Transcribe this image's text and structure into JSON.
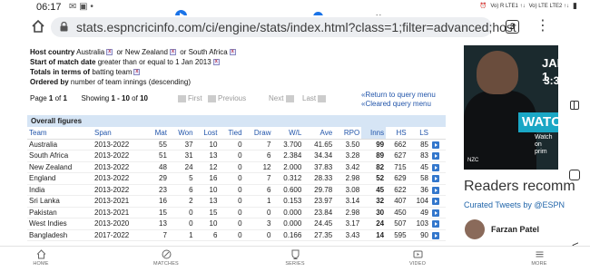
{
  "status": {
    "time": "06:17",
    "network_left": "Vo) R LTE1 ↑↓",
    "network_right": "Vo) LTE LTE2 ↑↓"
  },
  "browser": {
    "url": "stats.espncricinfo.com/ci/engine/stats/index.html?class=1;filter=advanced;host",
    "tab_count": "3"
  },
  "criteria": [
    {
      "label": "Host country",
      "text": "Australia",
      "extra": [
        {
          "prefix": "or",
          "value": "New Zealand"
        },
        {
          "prefix": "or",
          "value": "South Africa"
        }
      ]
    },
    {
      "label": "Start of match date",
      "text": "greater than or equal to 1 Jan 2013",
      "extra": []
    },
    {
      "label": "Totals in terms of",
      "text": "batting team",
      "extra": []
    },
    {
      "label": "Ordered by",
      "text": "number of team innings (descending)",
      "extra": []
    }
  ],
  "pager": {
    "page_label": "Page",
    "page_num": "1",
    "of_label": "of",
    "page_total": "1",
    "showing_label": "Showing",
    "showing_range": "1 - 10",
    "showing_of": "of",
    "showing_total": "10",
    "first": "First",
    "previous": "Previous",
    "next": "Next",
    "last": "Last"
  },
  "query_links": {
    "return": "Return to query menu",
    "cleared": "Cleared query menu"
  },
  "table": {
    "section_title": "Overall figures",
    "columns": [
      "Team",
      "Span",
      "Mat",
      "Won",
      "Lost",
      "Tied",
      "Draw",
      "W/L",
      "Ave",
      "RPO",
      "Inns",
      "HS",
      "LS"
    ],
    "sorted_column": "Inns",
    "rows": [
      [
        "Australia",
        "2013-2022",
        "55",
        "37",
        "10",
        "0",
        "7",
        "3.700",
        "41.65",
        "3.50",
        "99",
        "662",
        "85"
      ],
      [
        "South Africa",
        "2013-2022",
        "51",
        "31",
        "13",
        "0",
        "6",
        "2.384",
        "34.34",
        "3.28",
        "89",
        "627",
        "83"
      ],
      [
        "New Zealand",
        "2013-2022",
        "48",
        "24",
        "12",
        "0",
        "12",
        "2.000",
        "37.83",
        "3.42",
        "82",
        "715",
        "45"
      ],
      [
        "England",
        "2013-2022",
        "29",
        "5",
        "16",
        "0",
        "7",
        "0.312",
        "28.33",
        "2.98",
        "52",
        "629",
        "58"
      ],
      [
        "India",
        "2013-2022",
        "23",
        "6",
        "10",
        "0",
        "6",
        "0.600",
        "29.78",
        "3.08",
        "45",
        "622",
        "36"
      ],
      [
        "Sri Lanka",
        "2013-2021",
        "16",
        "2",
        "13",
        "0",
        "1",
        "0.153",
        "23.97",
        "3.14",
        "32",
        "407",
        "104"
      ],
      [
        "Pakistan",
        "2013-2021",
        "15",
        "0",
        "15",
        "0",
        "0",
        "0.000",
        "23.84",
        "2.98",
        "30",
        "450",
        "49"
      ],
      [
        "West Indies",
        "2013-2020",
        "13",
        "0",
        "10",
        "0",
        "3",
        "0.000",
        "24.45",
        "3.17",
        "24",
        "507",
        "103"
      ],
      [
        "Bangladesh",
        "2017-2022",
        "7",
        "1",
        "6",
        "0",
        "0",
        "0.166",
        "27.35",
        "3.43",
        "14",
        "595",
        "90"
      ]
    ]
  },
  "sidebar": {
    "ad_line1": "JAN 1",
    "ad_line2": "3:3",
    "ad_watch": "WATC",
    "ad_prime": "Watch on\nprim",
    "ad_badge": "NZC",
    "readers_heading": "Readers recomm",
    "curated": "Curated Tweets by @ESPN",
    "tweet_author": "Farzan Patel"
  },
  "bottom_nav": [
    {
      "label": "HOME",
      "icon": "home-icon"
    },
    {
      "label": "MATCHES",
      "icon": "matches-icon"
    },
    {
      "label": "SERIES",
      "icon": "series-icon"
    },
    {
      "label": "VIDEO",
      "icon": "video-icon"
    },
    {
      "label": "MORE",
      "icon": "more-icon"
    }
  ],
  "colors": {
    "link": "#2255aa",
    "header_bg": "#d6e5f5",
    "accent": "#1a73e8"
  }
}
